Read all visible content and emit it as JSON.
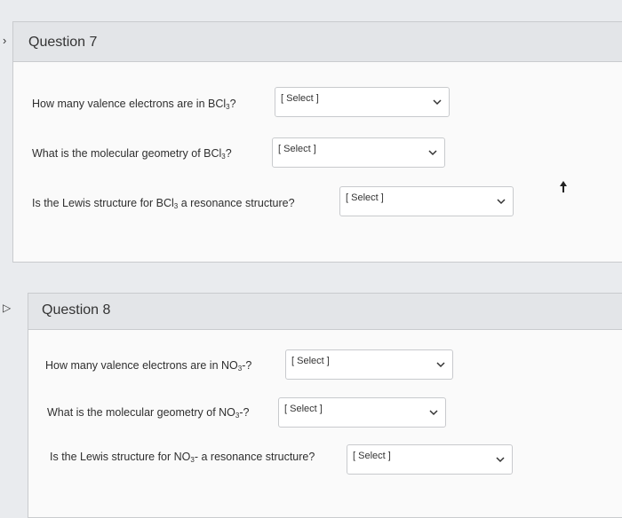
{
  "questions": [
    {
      "title": "Question 7",
      "items": [
        {
          "text_main": "How many valence electrons are in BCl",
          "text_sub": "3",
          "text_tail": "?",
          "select": "[ Select ]"
        },
        {
          "text_main": "What is the molecular geometry of BCl",
          "text_sub": "3",
          "text_tail": "?",
          "select": "[ Select ]"
        },
        {
          "text_main": "Is the Lewis structure for BCl",
          "text_sub": "3",
          "text_tail": " a resonance structure?",
          "select": "[ Select ]"
        }
      ]
    },
    {
      "title": "Question 8",
      "items": [
        {
          "text_main": "How many valence electrons are in NO",
          "text_sub": "3",
          "text_tail": "-?",
          "select": "[ Select ]"
        },
        {
          "text_main": "What is the molecular geometry of NO",
          "text_sub": "3",
          "text_tail": "-?",
          "select": "[ Select ]"
        },
        {
          "text_main": "Is the Lewis structure for NO",
          "text_sub": "3",
          "text_tail": "- a resonance structure?",
          "select": "[ Select ]"
        }
      ]
    }
  ],
  "icons": {
    "select_arrow": "chevron-down-icon",
    "flag": "flag-icon",
    "cursor": "mouse-cursor-icon"
  }
}
